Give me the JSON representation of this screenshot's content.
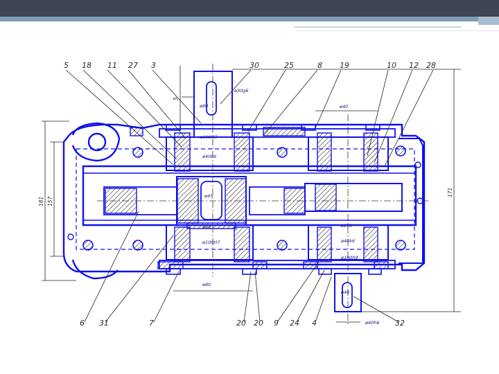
{
  "drawing": {
    "top_labels": [
      "5",
      "18",
      "11",
      "27",
      "3",
      "30",
      "25",
      "8",
      "19",
      "10",
      "12",
      "28"
    ],
    "bottom_labels": [
      "6",
      "31",
      "7",
      "20",
      "20",
      "9",
      "24",
      "4",
      "32"
    ],
    "dimensions": {
      "input_shaft_dia": "ø30g6",
      "input_bore_top": "ø80",
      "bore_h7_top": "ø100H7",
      "bore_k6_top": "ø40k6",
      "center_shaft": "ø45",
      "center_hub": "ø48",
      "bore_h7_bottom": "ø100H7",
      "bore_bottom_left": "ø80",
      "output_top": "ø40",
      "output_mid": "ø100",
      "output_k6": "ø40k6",
      "output_h9": "ø100h9",
      "output_shaft_dia": "ø40",
      "output_bottom": "ø40h6",
      "left_outer": "181",
      "left_inner": "157",
      "right_height": "171",
      "small_dim": "5"
    },
    "colors": {
      "outline": "#1010ee",
      "dimension": "#222222",
      "hatch": "#2a2a2a"
    }
  }
}
